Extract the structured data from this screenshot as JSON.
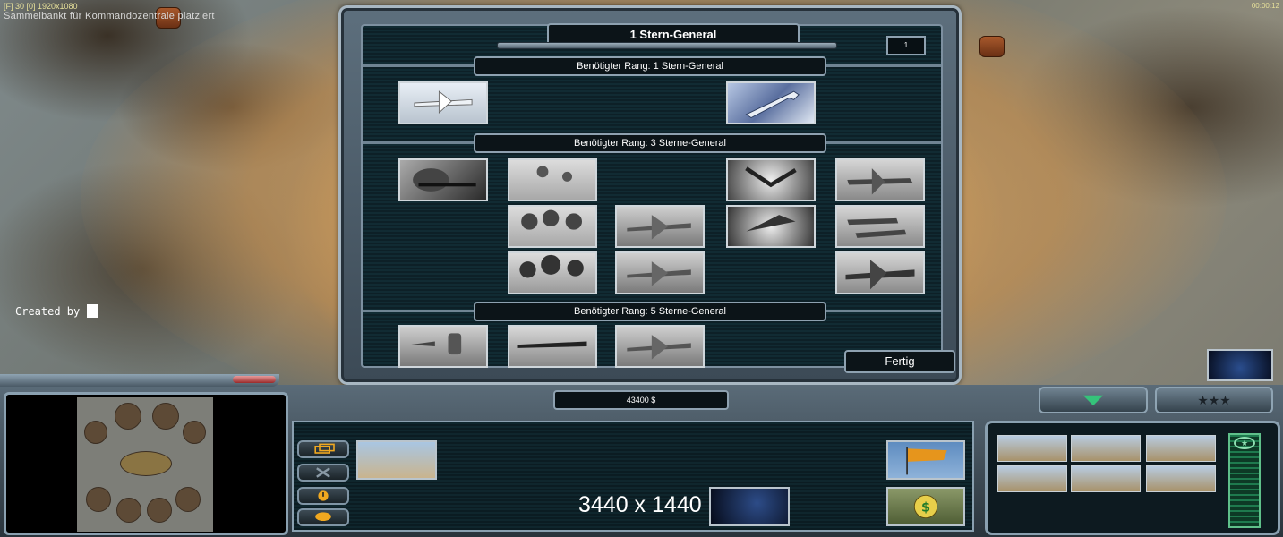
{
  "hud": {
    "status_text": "Sammelbankt für Kommandozentrale platziert",
    "top_left_fps": "[F] 30 [0] 1920x1080",
    "top_right_timer": "00:00:12"
  },
  "overlay": {
    "created_by": "Created by"
  },
  "general_window": {
    "title": "1 Stern-General",
    "points": "1",
    "rank1_label": "Benötigter Rang: 1 Stern-General",
    "rank3_label": "Benötigter Rang: 3 Sterne-General",
    "rank5_label": "Benötigter Rang: 5 Sterne-General",
    "done_button": "Fertig",
    "rank1_icons": [
      "drone-icon",
      "wrench-icon"
    ],
    "rank3_icons": [
      "sniper-icon",
      "paradrop-1-icon",
      "paradrop-2-icon",
      "paradrop-3-icon",
      "a10-strike-1-icon",
      "a10-strike-2-icon",
      "emp-icon",
      "spectre-icon",
      "fighter-1-icon",
      "fighter-2-icon",
      "bomber-icon"
    ],
    "rank5_icons": [
      "fuel-air-bomb-icon",
      "b52-bomber-icon",
      "a10-strike-3-icon"
    ]
  },
  "command_bar": {
    "money": "43400 $",
    "resolution_text": "3440 x 1440",
    "icons": {
      "selected_unit": "dozer-icon",
      "satellite": "satellite-icon",
      "flag": "flag-icon",
      "cash": "cash-icon",
      "buildings": [
        "war-factory-icon",
        "war-factory-icon",
        "war-factory-icon",
        "war-factory-icon",
        "war-factory-icon",
        "war-factory-icon"
      ]
    },
    "colors": {
      "panel_border": "#8aa0b0",
      "power_green": "#1e7a4e",
      "flag_orange": "#e6951c"
    }
  }
}
